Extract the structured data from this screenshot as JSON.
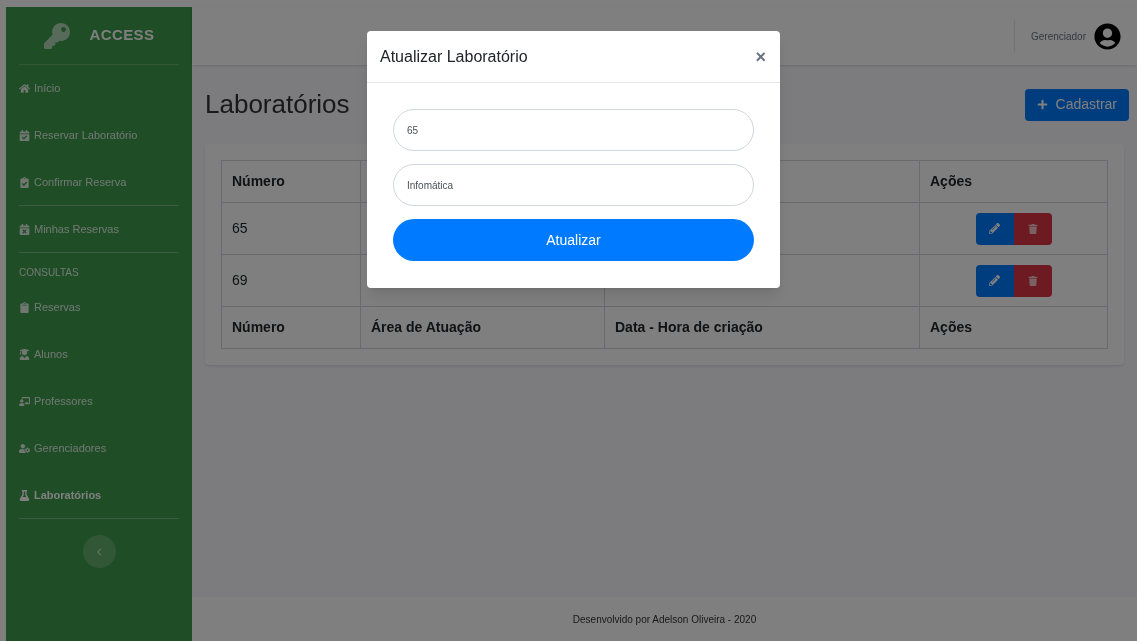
{
  "brand": {
    "title": "ACCESS"
  },
  "sidebar": {
    "items": [
      {
        "label": "Início",
        "selected": false,
        "divider_after": false
      },
      {
        "label": "Reservar Laboratório",
        "selected": false,
        "divider_after": false
      },
      {
        "label": "Confirmar Reserva",
        "selected": false,
        "divider_after": true
      },
      {
        "label": "Minhas Reservas",
        "selected": false,
        "divider_after": true
      }
    ],
    "section_heading": "CONSULTAS",
    "section_items": [
      {
        "label": "Reservas",
        "selected": false,
        "divider_after": false
      },
      {
        "label": "Alunos",
        "selected": false,
        "divider_after": false
      },
      {
        "label": "Professores",
        "selected": false,
        "divider_after": false
      },
      {
        "label": "Gerenciadores",
        "selected": false,
        "divider_after": false
      },
      {
        "label": "Laboratórios",
        "selected": true,
        "divider_after": true
      }
    ]
  },
  "topbar": {
    "user": "Gerenciador"
  },
  "page": {
    "title": "Laboratórios",
    "add_button": "Cadastrar"
  },
  "table": {
    "header": {
      "column_1": "Número",
      "column_4": "Ações"
    },
    "rows": [
      {
        "number": "65"
      },
      {
        "number": "69"
      }
    ],
    "footer": [
      "Número",
      "Área de Atuação",
      "Data - Hora de criação",
      "Ações"
    ]
  },
  "footer": {
    "text": "Desenvolvido por Adelson Oliveira - 2020"
  },
  "modal": {
    "title": "Atualizar Laboratório",
    "close": "×",
    "fields": [
      {
        "value": "65"
      },
      {
        "value": "Infomática"
      }
    ],
    "submit": "Atualizar"
  }
}
